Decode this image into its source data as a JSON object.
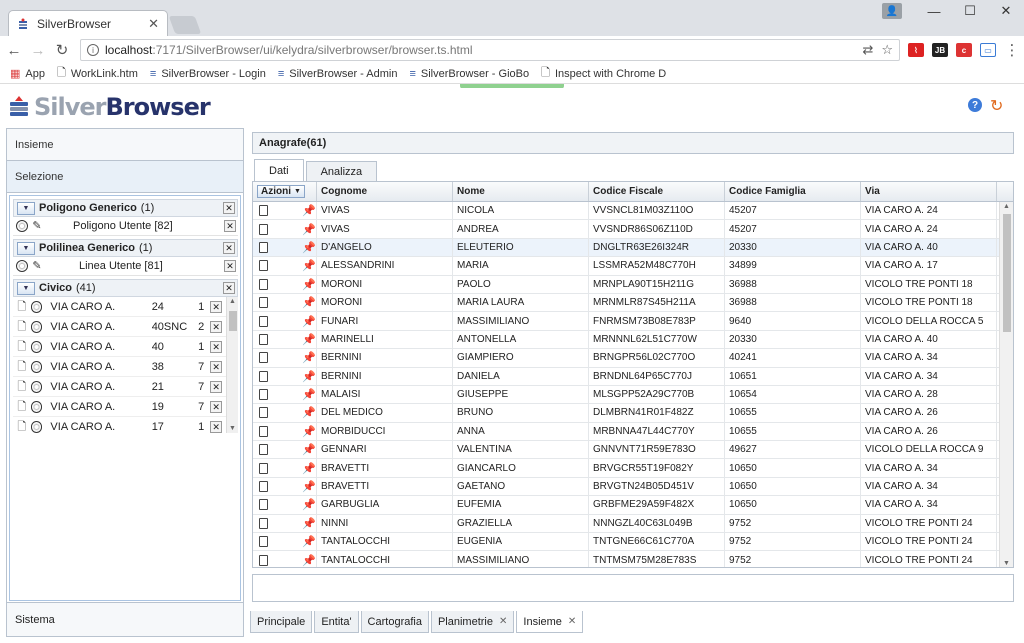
{
  "browser": {
    "tab_title": "SilverBrowser",
    "url_host": "localhost",
    "url_path": ":7171/SilverBrowser/ui/kelydra/silverbrowser/browser.ts.html",
    "bookmarks": [
      {
        "label": "App",
        "icon": "apps-icon"
      },
      {
        "label": "WorkLink.htm",
        "icon": "page-icon"
      },
      {
        "label": "SilverBrowser - Login",
        "icon": "silverbrowser-icon"
      },
      {
        "label": "SilverBrowser - Admin",
        "icon": "silverbrowser-icon"
      },
      {
        "label": "SilverBrowser - GioBo",
        "icon": "silverbrowser-icon"
      },
      {
        "label": "Inspect with Chrome D",
        "icon": "page-icon"
      }
    ]
  },
  "app": {
    "logo_silver": "Silver",
    "logo_browser": "Browser",
    "help": "?"
  },
  "left": {
    "insieme": "Insieme",
    "selezione": "Selezione",
    "sistema": "Sistema",
    "groups": [
      {
        "title": "Poligono Generico",
        "count": "(1)",
        "items": [
          "Poligono Utente [82]"
        ]
      },
      {
        "title": "Polilinea Generico",
        "count": "(1)",
        "items": [
          "Linea Utente [81]"
        ]
      }
    ],
    "civico": {
      "title": "Civico",
      "count": "(41)",
      "rows": [
        {
          "via": "VIA CARO A.",
          "num": "24",
          "cnt": "1"
        },
        {
          "via": "VIA CARO A.",
          "num": "40SNC",
          "cnt": "2"
        },
        {
          "via": "VIA CARO A.",
          "num": "40",
          "cnt": "1"
        },
        {
          "via": "VIA CARO A.",
          "num": "38",
          "cnt": "7"
        },
        {
          "via": "VIA CARO A.",
          "num": "21",
          "cnt": "7"
        },
        {
          "via": "VIA CARO A.",
          "num": "19",
          "cnt": "7"
        },
        {
          "via": "VIA CARO A.",
          "num": "17",
          "cnt": "1"
        }
      ]
    }
  },
  "main": {
    "title": "Anagrafe(61)",
    "tabs": [
      "Dati",
      "Analizza"
    ],
    "columns": [
      "Azioni",
      "Cognome",
      "Nome",
      "Codice Fiscale",
      "Codice Famiglia",
      "Via"
    ],
    "rows": [
      [
        "VIVAS",
        "NICOLA",
        "VVSNCL81M03Z110O",
        "45207",
        "VIA CARO A. 24"
      ],
      [
        "VIVAS",
        "ANDREA",
        "VVSNDR86S06Z110D",
        "45207",
        "VIA CARO A. 24"
      ],
      [
        "D'ANGELO",
        "ELEUTERIO",
        "DNGLTR63E26I324R",
        "20330",
        "VIA CARO A. 40"
      ],
      [
        "ALESSANDRINI",
        "MARIA",
        "LSSMRA52M48C770H",
        "34899",
        "VIA CARO A. 17"
      ],
      [
        "MORONI",
        "PAOLO",
        "MRNPLA90T15H211G",
        "36988",
        "VICOLO TRE PONTI 18"
      ],
      [
        "MORONI",
        "MARIA LAURA",
        "MRNMLR87S45H211A",
        "36988",
        "VICOLO TRE PONTI 18"
      ],
      [
        "FUNARI",
        "MASSIMILIANO",
        "FNRMSM73B08E783P",
        "9640",
        "VICOLO DELLA ROCCA 5"
      ],
      [
        "MARINELLI",
        "ANTONELLA",
        "MRNNNL62L51C770W",
        "20330",
        "VIA CARO A. 40"
      ],
      [
        "BERNINI",
        "GIAMPIERO",
        "BRNGPR56L02C770O",
        "40241",
        "VIA CARO A. 34"
      ],
      [
        "BERNINI",
        "DANIELA",
        "BRNDNL64P65C770J",
        "10651",
        "VIA CARO A. 34"
      ],
      [
        "MALAISI",
        "GIUSEPPE",
        "MLSGPP52A29C770B",
        "10654",
        "VIA CARO A. 28"
      ],
      [
        "DEL MEDICO",
        "BRUNO",
        "DLMBRN41R01F482Z",
        "10655",
        "VIA CARO A. 26"
      ],
      [
        "MORBIDUCCI",
        "ANNA",
        "MRBNNA47L44C770Y",
        "10655",
        "VIA CARO A. 26"
      ],
      [
        "GENNARI",
        "VALENTINA",
        "GNNVNT71R59E783O",
        "49627",
        "VICOLO DELLA ROCCA 9"
      ],
      [
        "BRAVETTI",
        "GIANCARLO",
        "BRVGCR55T19F082Y",
        "10650",
        "VIA CARO A. 34"
      ],
      [
        "BRAVETTI",
        "GAETANO",
        "BRVGTN24B05D451V",
        "10650",
        "VIA CARO A. 34"
      ],
      [
        "GARBUGLIA",
        "EUFEMIA",
        "GRBFME29A59F482X",
        "10650",
        "VIA CARO A. 34"
      ],
      [
        "NINNI",
        "GRAZIELLA",
        "NNNGZL40C63L049B",
        "9752",
        "VICOLO TRE PONTI 24"
      ],
      [
        "TANTALOCCHI",
        "EUGENIA",
        "TNTGNE66C61C770A",
        "9752",
        "VICOLO TRE PONTI 24"
      ],
      [
        "TANTALOCCHI",
        "MASSIMILIANO",
        "TNTMSM75M28E783S",
        "9752",
        "VICOLO TRE PONTI 24"
      ]
    ]
  },
  "bottom_tabs": [
    {
      "label": "Principale",
      "closable": false,
      "active": false
    },
    {
      "label": "Entita'",
      "closable": false,
      "active": false
    },
    {
      "label": "Cartografia",
      "closable": false,
      "active": false
    },
    {
      "label": "Planimetrie",
      "closable": true,
      "active": false
    },
    {
      "label": "Insieme",
      "closable": true,
      "active": true
    }
  ],
  "colors": {
    "accent": "#27336b",
    "logo_grey": "#9aa3b0",
    "selection": "#ecf3fb"
  }
}
